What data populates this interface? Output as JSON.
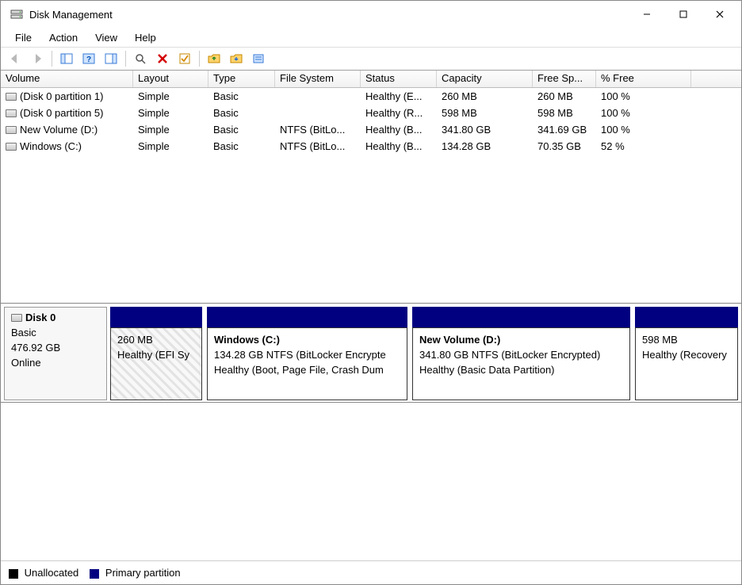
{
  "window": {
    "title": "Disk Management"
  },
  "menu": {
    "file": "File",
    "action": "Action",
    "view": "View",
    "help": "Help"
  },
  "columns": {
    "volume": "Volume",
    "layout": "Layout",
    "type": "Type",
    "file_system": "File System",
    "status": "Status",
    "capacity": "Capacity",
    "free_space": "Free Sp...",
    "pct_free": "% Free"
  },
  "volumes": [
    {
      "name": "(Disk 0 partition 1)",
      "layout": "Simple",
      "type": "Basic",
      "fs": "",
      "status": "Healthy (E...",
      "capacity": "260 MB",
      "free": "260 MB",
      "pct": "100 %"
    },
    {
      "name": "(Disk 0 partition 5)",
      "layout": "Simple",
      "type": "Basic",
      "fs": "",
      "status": "Healthy (R...",
      "capacity": "598 MB",
      "free": "598 MB",
      "pct": "100 %"
    },
    {
      "name": "New Volume (D:)",
      "layout": "Simple",
      "type": "Basic",
      "fs": "NTFS (BitLo...",
      "status": "Healthy (B...",
      "capacity": "341.80 GB",
      "free": "341.69 GB",
      "pct": "100 %"
    },
    {
      "name": "Windows (C:)",
      "layout": "Simple",
      "type": "Basic",
      "fs": "NTFS (BitLo...",
      "status": "Healthy (B...",
      "capacity": "134.28 GB",
      "free": "70.35 GB",
      "pct": "52 %"
    }
  ],
  "disk": {
    "name": "Disk 0",
    "type": "Basic",
    "capacity": "476.92 GB",
    "state": "Online",
    "partitions": [
      {
        "title": "",
        "l1": "260 MB",
        "l2": "Healthy (EFI Sy"
      },
      {
        "title": "Windows  (C:)",
        "l1": "134.28 GB NTFS (BitLocker Encrypte",
        "l2": "Healthy (Boot, Page File, Crash Dum"
      },
      {
        "title": "New Volume  (D:)",
        "l1": "341.80 GB NTFS (BitLocker Encrypted)",
        "l2": "Healthy (Basic Data Partition)"
      },
      {
        "title": "",
        "l1": "598 MB",
        "l2": "Healthy (Recovery"
      }
    ]
  },
  "legend": {
    "unallocated": "Unallocated",
    "primary": "Primary partition"
  }
}
